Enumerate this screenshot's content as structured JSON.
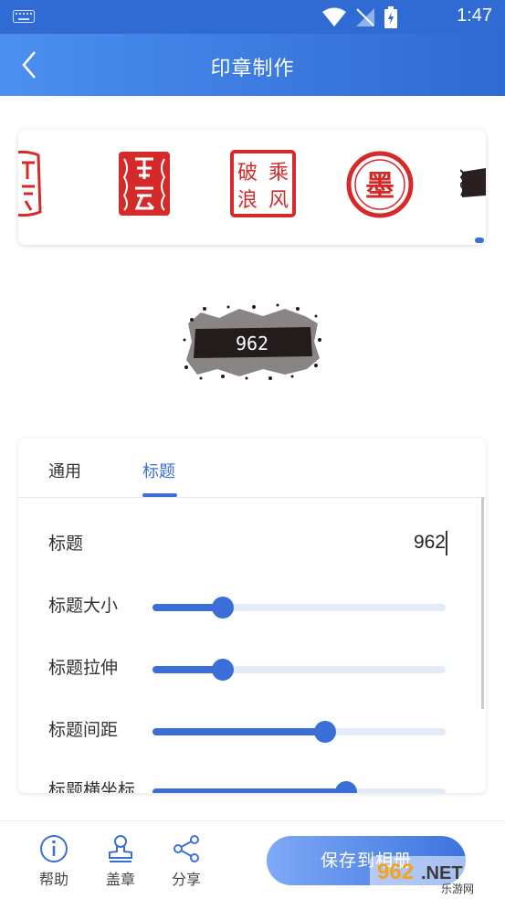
{
  "status_bar": {
    "time": "1:47"
  },
  "header": {
    "title": "印章制作"
  },
  "seals": [
    {
      "name": "seal-fuyun-partial",
      "color": "#d42a2a"
    },
    {
      "name": "seal-fuyun",
      "color": "#d42a2a"
    },
    {
      "name": "seal-chengfeng-polang",
      "chars": [
        "乘",
        "破",
        "风",
        "浪"
      ],
      "color": "#d42a2a"
    },
    {
      "name": "seal-mo",
      "chars": [
        "墨"
      ],
      "color": "#d42a2a"
    }
  ],
  "preview": {
    "text": "962"
  },
  "tabs": [
    {
      "label": "通用",
      "active": false
    },
    {
      "label": "标题",
      "active": true
    }
  ],
  "settings": {
    "title_label": "标题",
    "title_value": "962",
    "sliders": [
      {
        "label": "标题大小",
        "value_pct": 24
      },
      {
        "label": "标题拉伸",
        "value_pct": 24
      },
      {
        "label": "标题间距",
        "value_pct": 59
      },
      {
        "label": "标题横坐标",
        "value_pct": 66
      }
    ]
  },
  "bottom_bar": {
    "help_label": "帮助",
    "stamp_label": "盖章",
    "share_label": "分享",
    "save_label": "保存到相册"
  },
  "watermark": {
    "text": "962.NET",
    "subtext": "乐游网"
  },
  "colors": {
    "accent": "#3b6fd8",
    "seal_red": "#d42a2a",
    "header_start": "#4b8ff0",
    "header_end": "#2f69d2"
  }
}
